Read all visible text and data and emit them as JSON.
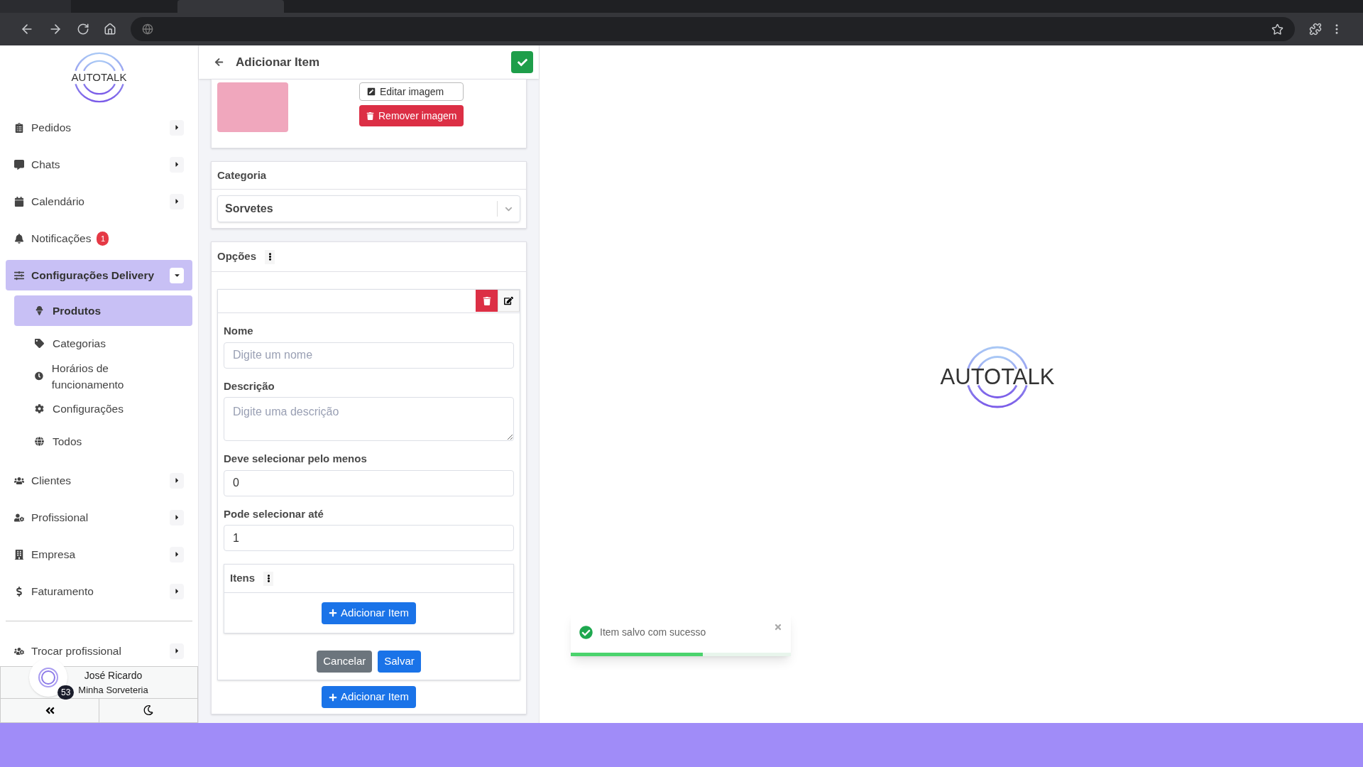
{
  "sidebar": {
    "logo": "AUTOTALK",
    "items": [
      {
        "label": "Pedidos",
        "expanded": false
      },
      {
        "label": "Chats",
        "expanded": false
      },
      {
        "label": "Calendário",
        "expanded": false
      },
      {
        "label": "Notificações",
        "badge": "1"
      },
      {
        "label": "Configurações Delivery",
        "expanded": true,
        "children": [
          {
            "label": "Produtos",
            "selected": true
          },
          {
            "label": "Categorias",
            "selected": false
          },
          {
            "label": "Horários de funcionamento",
            "selected": false
          },
          {
            "label": "Configurações",
            "selected": false
          },
          {
            "label": "Todos",
            "selected": false
          }
        ]
      },
      {
        "label": "Clientes",
        "expanded": false
      },
      {
        "label": "Profissional",
        "expanded": false
      },
      {
        "label": "Empresa",
        "expanded": false
      },
      {
        "label": "Faturamento",
        "expanded": false
      }
    ],
    "footer_items": [
      {
        "label": "Trocar profissional",
        "expanded": false
      }
    ],
    "user": {
      "name": "José Ricardo",
      "company": "Minha Sorveteria",
      "badge": "53"
    }
  },
  "form": {
    "title": "Adicionar Item",
    "image_buttons": [
      "Editar imagem",
      "Remover imagem"
    ],
    "category": {
      "title": "Categoria",
      "value": "Sorvetes"
    },
    "options": {
      "title": "Opções",
      "fields": [
        {
          "label": "Nome",
          "placeholder": "Digite um nome",
          "kind": "input"
        },
        {
          "label": "Descrição",
          "placeholder": "Digite uma descrição",
          "kind": "textarea"
        },
        {
          "label": "Deve selecionar pelo menos",
          "value": "0",
          "kind": "input"
        },
        {
          "label": "Pode selecionar até",
          "value": "1",
          "kind": "input"
        }
      ],
      "items_title": "Itens",
      "add_item": "Adicionar Item",
      "cancel": "Cancelar",
      "save": "Salvar"
    },
    "add_item": "Adicionar Item"
  },
  "splash_logo": "AUTOTALK",
  "toast": {
    "message": "Item salvo com sucesso",
    "level": 0.6
  }
}
